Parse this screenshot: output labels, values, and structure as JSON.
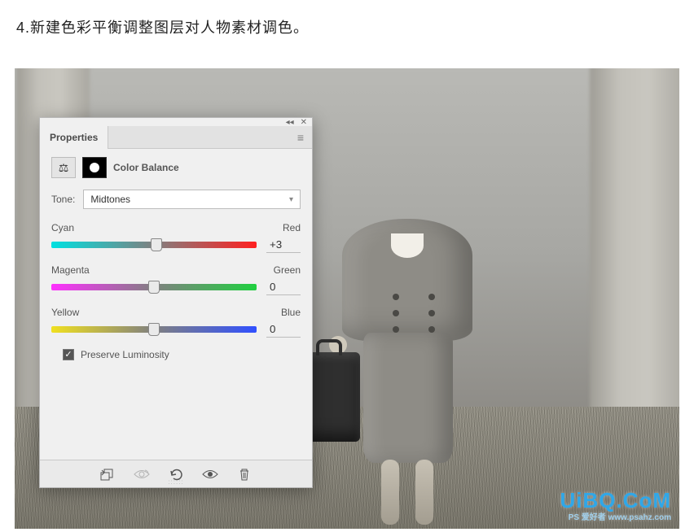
{
  "instruction": "4.新建色彩平衡调整图层对人物素材调色。",
  "panel": {
    "tab": "Properties",
    "title": "Color Balance",
    "tone_label": "Tone:",
    "tone_value": "Midtones",
    "sliders": {
      "cyan_red": {
        "left": "Cyan",
        "right": "Red",
        "value": "+3",
        "pos": 51
      },
      "magenta_green": {
        "left": "Magenta",
        "right": "Green",
        "value": "0",
        "pos": 50
      },
      "yellow_blue": {
        "left": "Yellow",
        "right": "Blue",
        "value": "0",
        "pos": 50
      }
    },
    "preserve_label": "Preserve Luminosity",
    "preserve_checked": true,
    "footer_icons": {
      "clip": "clip-to-layer-icon",
      "view_prev": "view-previous-icon",
      "reset": "reset-icon",
      "toggle": "visibility-icon",
      "delete": "delete-icon"
    }
  },
  "watermark": {
    "main": "UiBQ.CoM",
    "sub": "PS 爱好者  www.psahz.com"
  }
}
